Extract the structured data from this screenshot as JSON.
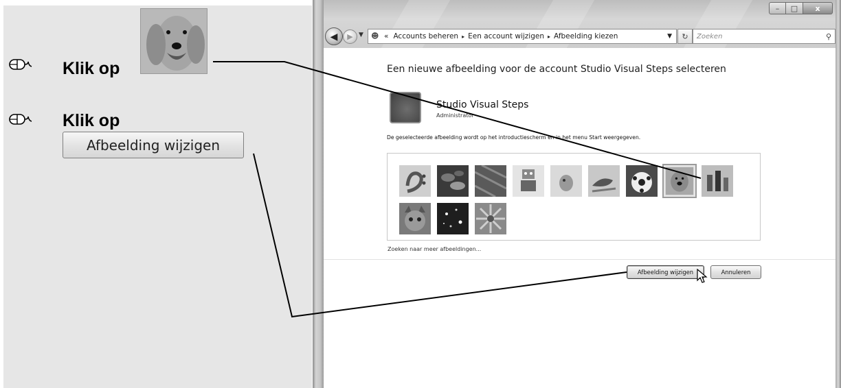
{
  "instructions": {
    "step1_text": "Klik op",
    "step2_text": "Klik op",
    "button_label": "Afbeelding wijzigen"
  },
  "window": {
    "caption_minimize": "–",
    "caption_maximize": "□",
    "caption_close": "x",
    "nav_back": "◀",
    "nav_forward": "▶",
    "address_prefix": "«",
    "breadcrumbs": [
      "Accounts beheren",
      "Een account wijzigen",
      "Afbeelding kiezen"
    ],
    "breadcrumb_separator": "▸",
    "search_placeholder": "Zoeken"
  },
  "content": {
    "heading": "Een nieuwe afbeelding voor de account Studio Visual Steps selecteren",
    "account_name": "Studio Visual Steps",
    "account_role": "Administrator",
    "info": "De geselecteerde afbeelding wordt op het introductiescherm en in het menu Start weergegeven.",
    "pictures": [
      "bass-clef",
      "leaves",
      "leather",
      "robot",
      "fish",
      "bird",
      "soccer-ball",
      "dog",
      "chess",
      "cat",
      "sparkles",
      "flower"
    ],
    "selected_picture": "dog",
    "more_link": "Zoeken naar meer afbeeldingen...",
    "change_button": "Afbeelding wijzigen",
    "cancel_button": "Annuleren"
  }
}
